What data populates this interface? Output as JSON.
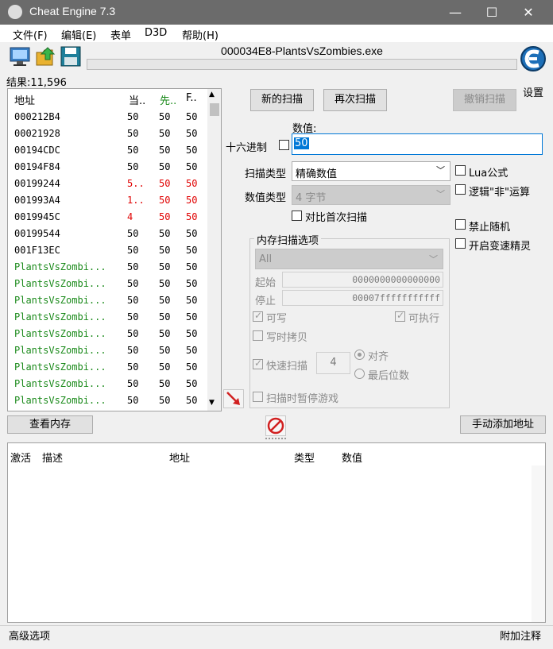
{
  "window": {
    "title": "Cheat Engine 7.3",
    "minimize": "—",
    "maximize": "☐",
    "close": "✕"
  },
  "menu": [
    "文件(F)",
    "编辑(E)",
    "表单",
    "D3D",
    "帮助(H)"
  ],
  "process_name": "000034E8-PlantsVsZombies.exe",
  "settings_label": "设置",
  "results_label": "结果:11,596",
  "list_headers": [
    "地址",
    "当..",
    "先..",
    "F.."
  ],
  "list_rows": [
    {
      "addr": "000212B4",
      "cur": "50",
      "prev": "50",
      "first": "50",
      "changed": false,
      "static": false
    },
    {
      "addr": "00021928",
      "cur": "50",
      "prev": "50",
      "first": "50",
      "changed": false,
      "static": false
    },
    {
      "addr": "00194CDC",
      "cur": "50",
      "prev": "50",
      "first": "50",
      "changed": false,
      "static": false
    },
    {
      "addr": "00194F84",
      "cur": "50",
      "prev": "50",
      "first": "50",
      "changed": false,
      "static": false
    },
    {
      "addr": "00199244",
      "cur": "5..",
      "prev": "50",
      "first": "50",
      "changed": true,
      "static": false
    },
    {
      "addr": "001993A4",
      "cur": "1..",
      "prev": "50",
      "first": "50",
      "changed": true,
      "static": false
    },
    {
      "addr": "0019945C",
      "cur": "4",
      "prev": "50",
      "first": "50",
      "changed": true,
      "static": false
    },
    {
      "addr": "00199544",
      "cur": "50",
      "prev": "50",
      "first": "50",
      "changed": false,
      "static": false
    },
    {
      "addr": "001F13EC",
      "cur": "50",
      "prev": "50",
      "first": "50",
      "changed": false,
      "static": false
    },
    {
      "addr": "PlantsVsZombi...",
      "cur": "50",
      "prev": "50",
      "first": "50",
      "changed": false,
      "static": true
    },
    {
      "addr": "PlantsVsZombi...",
      "cur": "50",
      "prev": "50",
      "first": "50",
      "changed": false,
      "static": true
    },
    {
      "addr": "PlantsVsZombi...",
      "cur": "50",
      "prev": "50",
      "first": "50",
      "changed": false,
      "static": true
    },
    {
      "addr": "PlantsVsZombi...",
      "cur": "50",
      "prev": "50",
      "first": "50",
      "changed": false,
      "static": true
    },
    {
      "addr": "PlantsVsZombi...",
      "cur": "50",
      "prev": "50",
      "first": "50",
      "changed": false,
      "static": true
    },
    {
      "addr": "PlantsVsZombi...",
      "cur": "50",
      "prev": "50",
      "first": "50",
      "changed": false,
      "static": true
    },
    {
      "addr": "PlantsVsZombi...",
      "cur": "50",
      "prev": "50",
      "first": "50",
      "changed": false,
      "static": true
    },
    {
      "addr": "PlantsVsZombi...",
      "cur": "50",
      "prev": "50",
      "first": "50",
      "changed": false,
      "static": true
    },
    {
      "addr": "PlantsVsZombi...",
      "cur": "50",
      "prev": "50",
      "first": "50",
      "changed": false,
      "static": true
    }
  ],
  "buttons": {
    "new_scan": "新的扫描",
    "next_scan": "再次扫描",
    "undo_scan": "撤销扫描",
    "view_memory": "查看内存",
    "add_address": "手动添加地址"
  },
  "value": {
    "label": "数值:",
    "input": "50",
    "hex_label": "十六进制"
  },
  "scan_type": {
    "label": "扫描类型",
    "selected": "精确数值"
  },
  "value_type": {
    "label": "数值类型",
    "selected": "4 字节"
  },
  "compare_first": "对比首次扫描",
  "options_right": {
    "lua": "Lua公式",
    "not": "逻辑\"非\"运算",
    "no_random": "禁止随机",
    "speedhack": "开启变速精灵"
  },
  "memory_options": {
    "title": "内存扫描选项",
    "region": "All",
    "start_label": "起始",
    "start_value": "0000000000000000",
    "stop_label": "停止",
    "stop_value": "00007fffffffffff",
    "writable": "可写",
    "executable": "可执行",
    "copy_on_write": "写时拷贝",
    "fast_scan": "快速扫描",
    "fast_scan_value": "4",
    "align": "对齐",
    "last_digits": "最后位数",
    "pause_game": "扫描时暂停游戏"
  },
  "table_headers": [
    "激活",
    "描述",
    "地址",
    "类型",
    "数值"
  ],
  "status": {
    "left": "高级选项",
    "right": "附加注释"
  },
  "colors": {
    "titlebar": "#6b6b6b",
    "changed": "#e00000",
    "static": "#1a8a1a",
    "selection": "#0078d7"
  }
}
